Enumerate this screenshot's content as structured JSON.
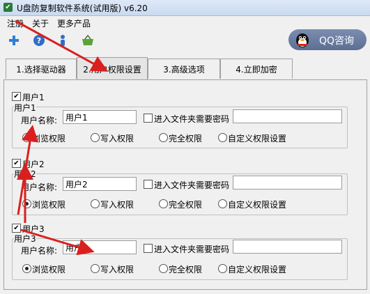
{
  "window": {
    "title": "U盘防复制软件系统(试用版) v6.20"
  },
  "menu": [
    "注册",
    "关于",
    "更多产品"
  ],
  "toolbar": {
    "icons": [
      "add-icon",
      "help-icon",
      "user-icon",
      "basket-icon"
    ]
  },
  "qq_button": {
    "label": "QQ咨询"
  },
  "tabs": [
    {
      "label": "1.选择驱动器"
    },
    {
      "label": "2.用户权限设置"
    },
    {
      "label": "3.高级选项"
    },
    {
      "label": "4.立即加密"
    }
  ],
  "active_tab": "2.用户权限设置",
  "users": [
    {
      "checkbox_label": "用户1",
      "group_title": "用户1",
      "name_label": "用户名称:",
      "name_value": "用户1",
      "password_option": "进入文件夹需要密码",
      "password_checked": false,
      "password_value": "",
      "permissions": [
        "浏览权限",
        "写入权限",
        "完全权限",
        "自定义权限设置"
      ],
      "selected_permission": "浏览权限"
    },
    {
      "checkbox_label": "用户2",
      "group_title": "用户2",
      "name_label": "用户名称:",
      "name_value": "用户2",
      "password_option": "进入文件夹需要密码",
      "password_checked": false,
      "password_value": "",
      "permissions": [
        "浏览权限",
        "写入权限",
        "完全权限",
        "自定义权限设置"
      ],
      "selected_permission": "浏览权限"
    },
    {
      "checkbox_label": "用户3",
      "group_title": "用户3",
      "name_label": "用户名称:",
      "name_value": "用户3",
      "password_option": "进入文件夹需要密码",
      "password_checked": false,
      "password_value": "",
      "permissions": [
        "浏览权限",
        "写入权限",
        "完全权限",
        "自定义权限设置"
      ],
      "selected_permission": "浏览权限"
    }
  ],
  "colors": {
    "annotation_arrow": "#d9201f",
    "qq_button_bg": "#6a7ca1"
  }
}
